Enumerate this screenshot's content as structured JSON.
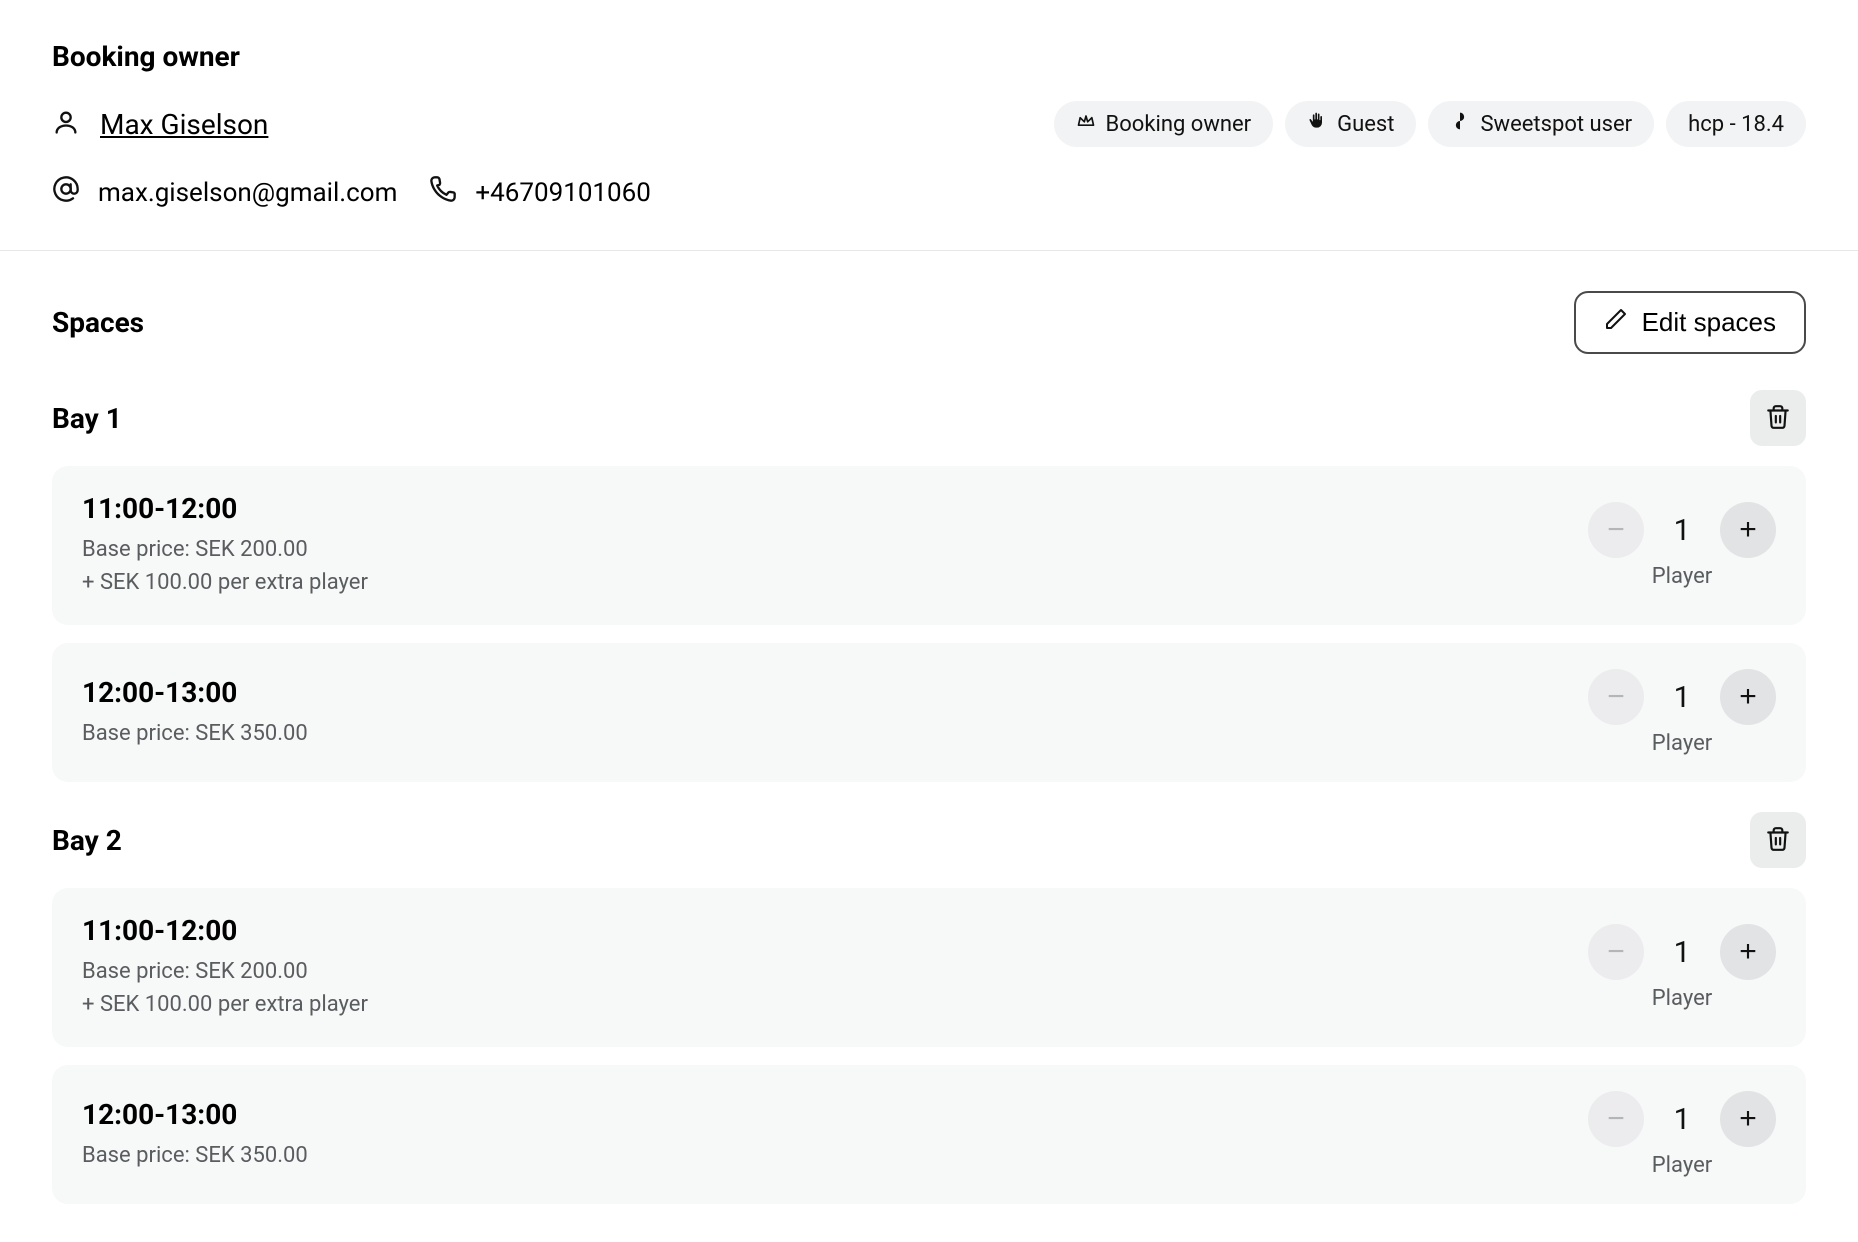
{
  "header": {
    "title": "Booking owner",
    "name": "Max Giselson",
    "email": "max.giselson@gmail.com",
    "phone": "+46709101060"
  },
  "tags": [
    {
      "icon": "crown-icon",
      "label": "Booking owner"
    },
    {
      "icon": "wave-icon",
      "label": "Guest"
    },
    {
      "icon": "sweetspot-icon",
      "label": "Sweetspot user"
    },
    {
      "icon": null,
      "label": "hcp - 18.4"
    }
  ],
  "spaces": {
    "title": "Spaces",
    "edit_label": "Edit spaces"
  },
  "bays": [
    {
      "name": "Bay 1",
      "slots": [
        {
          "time": "11:00-12:00",
          "base_price": "Base price: SEK 200.00",
          "extra": "+ SEK 100.00 per extra player",
          "count": "1",
          "unit": "Player"
        },
        {
          "time": "12:00-13:00",
          "base_price": "Base price: SEK 350.00",
          "extra": null,
          "count": "1",
          "unit": "Player"
        }
      ]
    },
    {
      "name": "Bay 2",
      "slots": [
        {
          "time": "11:00-12:00",
          "base_price": "Base price: SEK 200.00",
          "extra": "+ SEK 100.00 per extra player",
          "count": "1",
          "unit": "Player"
        },
        {
          "time": "12:00-13:00",
          "base_price": "Base price: SEK 350.00",
          "extra": null,
          "count": "1",
          "unit": "Player"
        }
      ]
    }
  ]
}
